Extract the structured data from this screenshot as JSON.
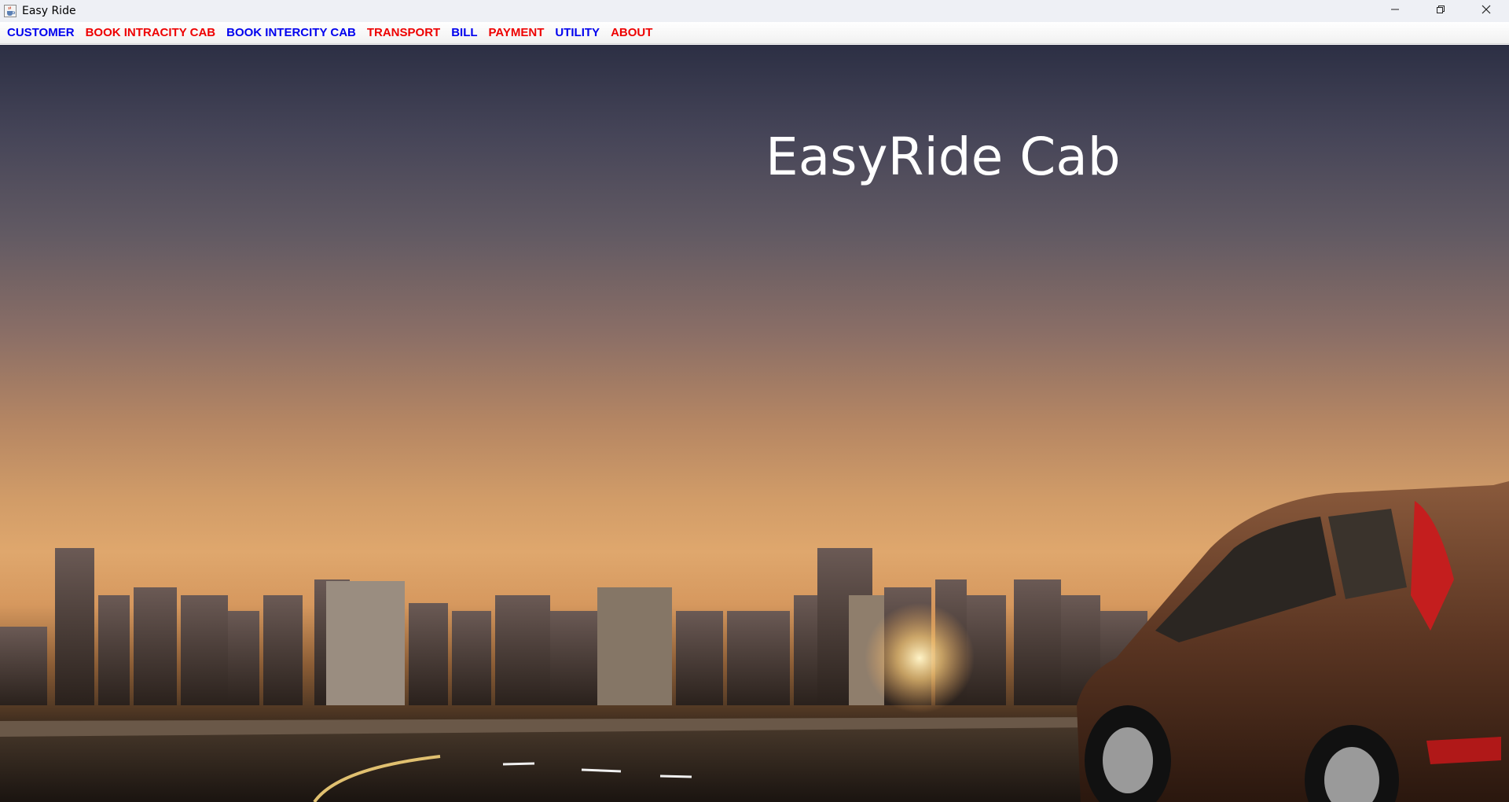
{
  "window": {
    "title": "Easy Ride",
    "icon": "java-cup-icon",
    "controls": [
      "minimize-icon",
      "restore-icon",
      "close-icon"
    ]
  },
  "menu": {
    "items": [
      {
        "label": "CUSTOMER",
        "color": "#0000ee"
      },
      {
        "label": "BOOK INTRACITY CAB",
        "color": "#ee0000"
      },
      {
        "label": "BOOK INTERCITY CAB",
        "color": "#0000ee"
      },
      {
        "label": "TRANSPORT",
        "color": "#ee0000"
      },
      {
        "label": "BILL",
        "color": "#0000ee"
      },
      {
        "label": "PAYMENT",
        "color": "#ee0000"
      },
      {
        "label": "UTILITY",
        "color": "#0000ee"
      },
      {
        "label": "ABOUT",
        "color": "#ee0000"
      }
    ]
  },
  "main": {
    "heading": "EasyRide Cab",
    "heading_color": "#ffffff",
    "background": "city-skyline-sunset-with-car-image"
  }
}
